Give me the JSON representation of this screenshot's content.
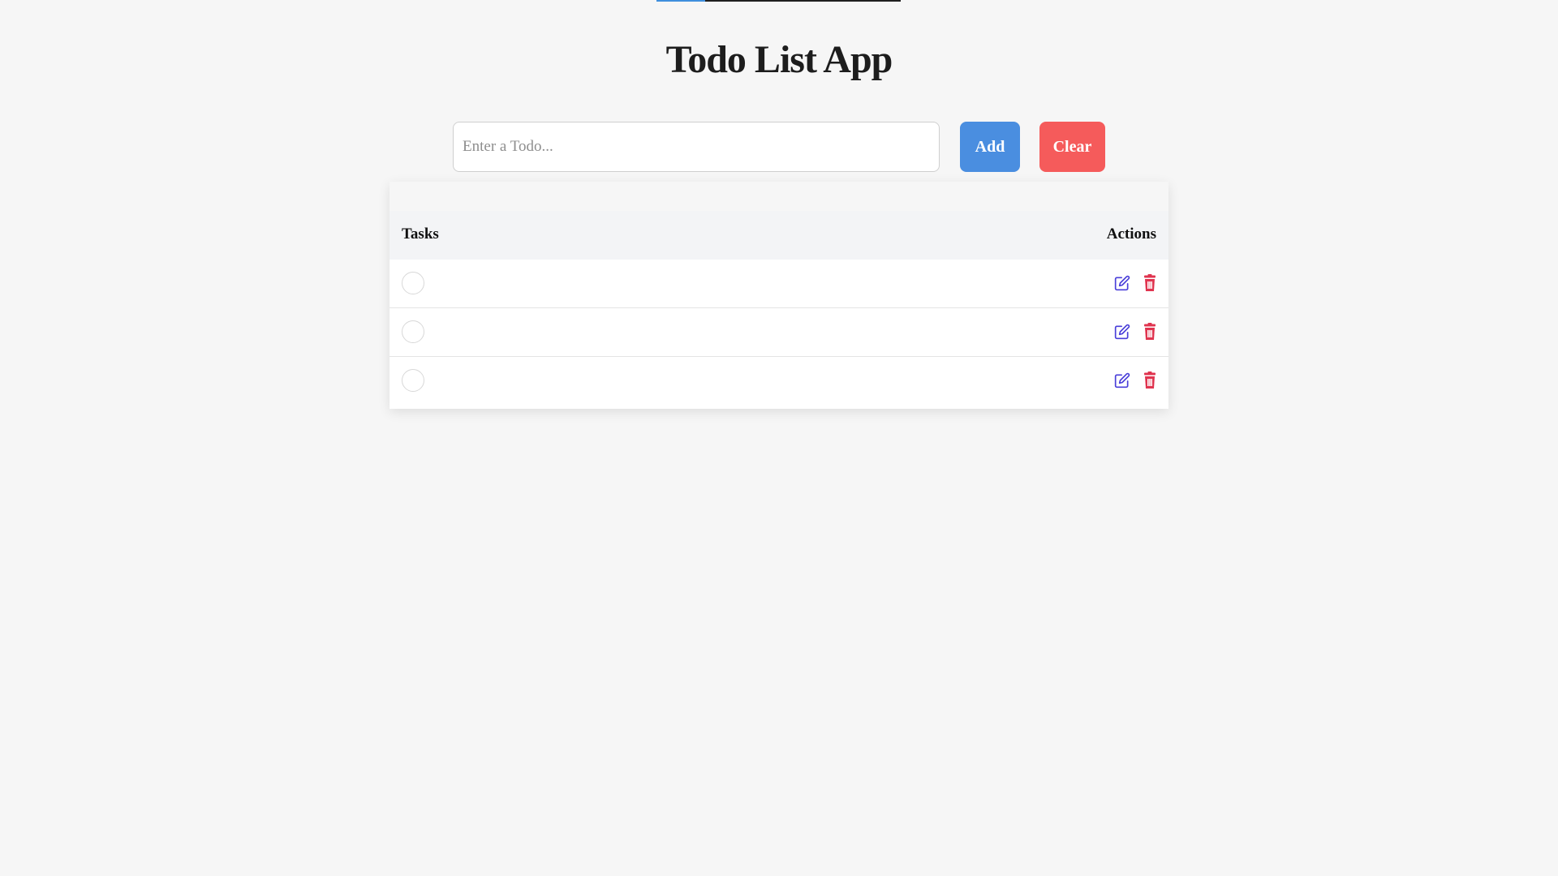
{
  "app": {
    "title": "Todo List App"
  },
  "progress": {
    "fraction": 0.2,
    "fill_color": "#3f8fdd"
  },
  "input": {
    "placeholder": "Enter a Todo...",
    "value": ""
  },
  "buttons": {
    "add_label": "Add",
    "clear_label": "Clear",
    "add_color": "#4a8ee0",
    "clear_color": "#f55b5b"
  },
  "table": {
    "headers": {
      "tasks": "Tasks",
      "actions": "Actions"
    },
    "rows": [
      {
        "task": "",
        "checked": false
      },
      {
        "task": "",
        "checked": false
      },
      {
        "task": "",
        "checked": false
      }
    ],
    "icons": {
      "edit": "edit-icon",
      "delete": "trash-icon",
      "edit_color": "#4a3fd9",
      "delete_color": "#e0344f"
    }
  }
}
